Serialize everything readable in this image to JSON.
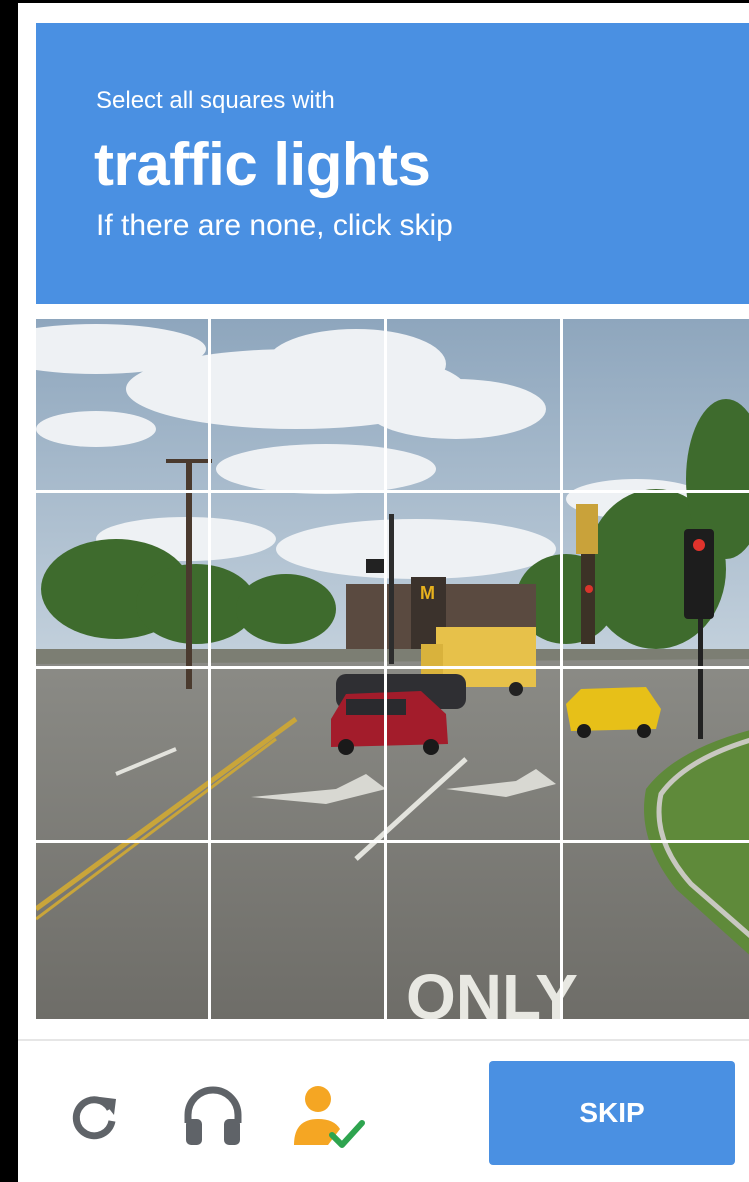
{
  "challenge": {
    "instruction_line1": "Select all squares with",
    "target": "traffic lights",
    "instruction_line3": "If there are none, click skip"
  },
  "grid": {
    "rows": 4,
    "cols": 4
  },
  "footer": {
    "icons": [
      "reload-icon",
      "headphones-icon",
      "person-check-icon"
    ],
    "skip_label": "SKIP"
  },
  "colors": {
    "accent": "#4a90e2",
    "check": "#2ea44f",
    "person": "#f5a623"
  }
}
